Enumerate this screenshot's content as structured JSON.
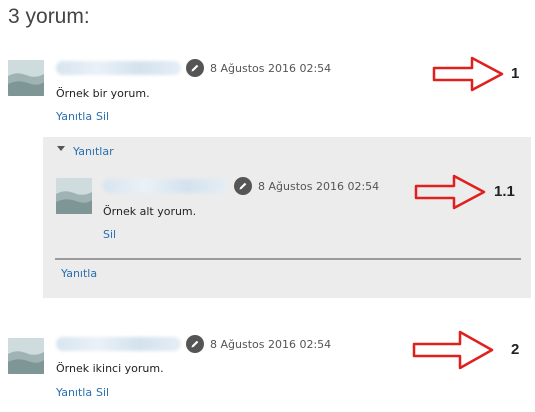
{
  "heading": "3 yorum:",
  "comments": [
    {
      "date": "8 Ağustos 2016 02:54",
      "text": "Örnek bir yorum.",
      "actions": [
        "Yanıtla",
        "Sil"
      ],
      "marker": "1"
    },
    {
      "date": "8 Ağustos 2016 02:54",
      "text": "Örnek ikinci yorum.",
      "actions": [
        "Yanıtla",
        "Sil"
      ],
      "marker": "2"
    }
  ],
  "replies": {
    "toggle_label": "Yanıtlar",
    "items": [
      {
        "date": "8 Ağustos 2016 02:54",
        "text": "Örnek alt yorum.",
        "actions": [
          "Sil"
        ],
        "marker": "1.1"
      }
    ],
    "reply_link": "Yanıtla"
  },
  "colors": {
    "link": "#2a6fb0",
    "arrow": "#e0201e",
    "panel": "#ececec"
  },
  "icons": [
    "pencil-icon",
    "triangle-down-icon",
    "arrow-icon"
  ]
}
